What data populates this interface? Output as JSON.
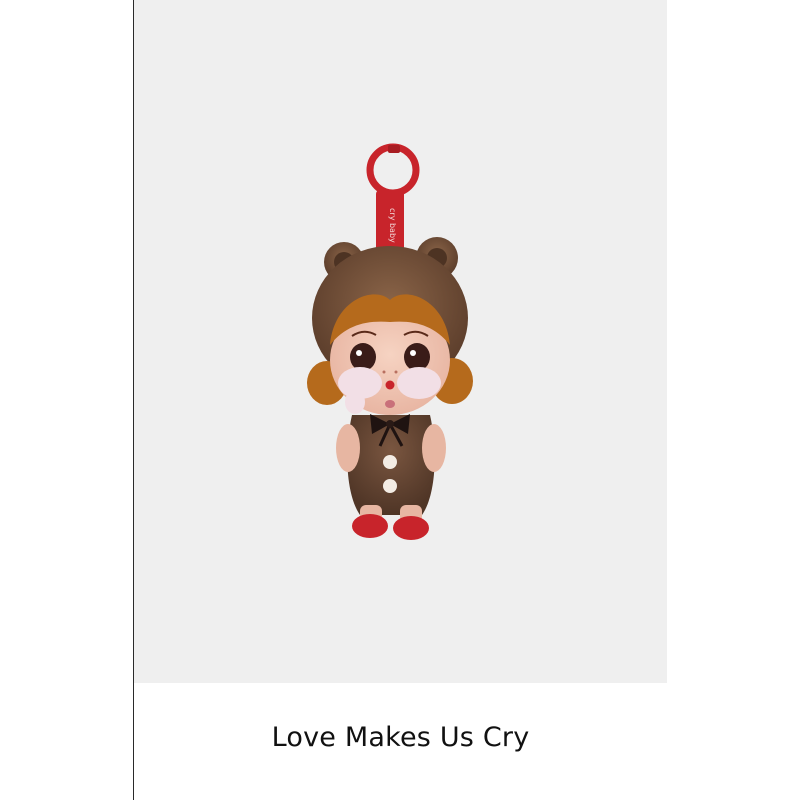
{
  "caption": "Love Makes Us Cry",
  "product_photo": {
    "name": "Crybaby bear plush keychain",
    "tag_text": "cry baby"
  },
  "colors": {
    "panel_background": "#efefef",
    "fur": "#6b4a35",
    "accent_red": "#c8242b",
    "hair": "#b56a1c"
  }
}
